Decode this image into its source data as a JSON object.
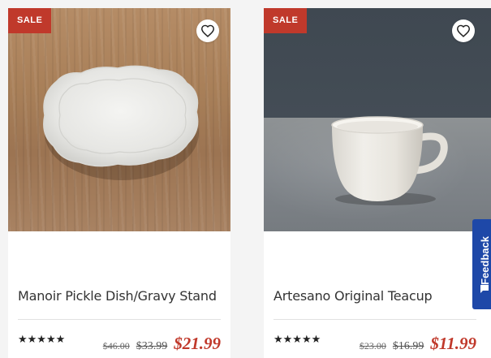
{
  "products": [
    {
      "badge": "SALE",
      "title": "Manoir Pickle Dish/Gravy Stand",
      "rating": "★★★★★",
      "original_price": "$46.00",
      "previous_price": "$33.99",
      "sale_price": "$21.99",
      "wishlist_icon": "heart-icon",
      "colors": {
        "badge": "#c0392b",
        "sale_price": "#c0392b"
      }
    },
    {
      "badge": "SALE",
      "title": "Artesano Original Teacup",
      "rating": "★★★★★",
      "original_price": "$23.00",
      "previous_price": "$16.99",
      "sale_price": "$11.99",
      "wishlist_icon": "heart-icon",
      "colors": {
        "badge": "#c0392b",
        "sale_price": "#c0392b"
      }
    }
  ],
  "feedback": {
    "label": "Feedback",
    "icon": "chat-icon",
    "color": "#1e48a8"
  }
}
